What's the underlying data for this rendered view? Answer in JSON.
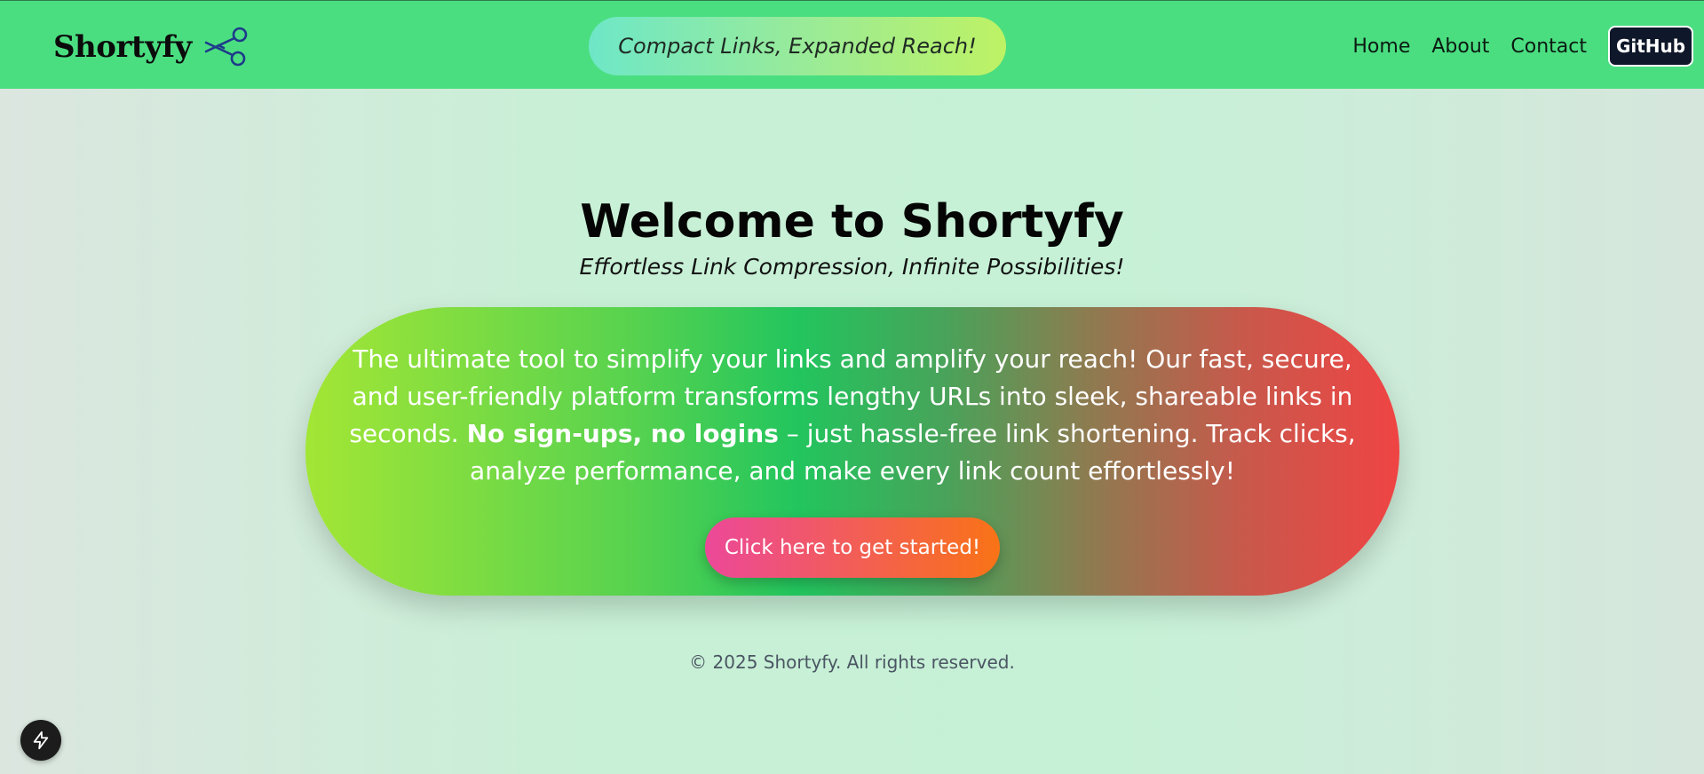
{
  "header": {
    "brand": "Shortyfy",
    "brand_icon": "scissors-icon",
    "tagline": "Compact Links, Expanded Reach!",
    "nav": {
      "home": "Home",
      "about": "About",
      "contact": "Contact",
      "github": "GitHub"
    }
  },
  "hero": {
    "title": "Welcome to Shortyfy",
    "subtitle": "Effortless Link Compression, Infinite Possibilities!",
    "description_before": "The ultimate tool to simplify your links and amplify your reach! Our fast, secure, and user-friendly platform transforms lengthy URLs into sleek, shareable links in seconds. ",
    "description_bold": "No sign-ups, no logins",
    "description_after": " – just hassle-free link shortening. Track clicks, analyze performance, and make every link count effortlessly!",
    "cta": "Click here to get started!"
  },
  "footer": {
    "copyright": "© 2025 Shortyfy. All rights reserved."
  },
  "dev_tool": {
    "icon": "bolt-icon"
  },
  "colors": {
    "header_bg": "#4ade80",
    "github_bg": "#0f172a",
    "card_gradient": [
      "#a3e635",
      "#22c55e",
      "#ef4444"
    ],
    "cta_gradient": [
      "#ec4899",
      "#f97316"
    ],
    "tagline_gradient": [
      "#6ee7c7",
      "#bef264"
    ]
  }
}
